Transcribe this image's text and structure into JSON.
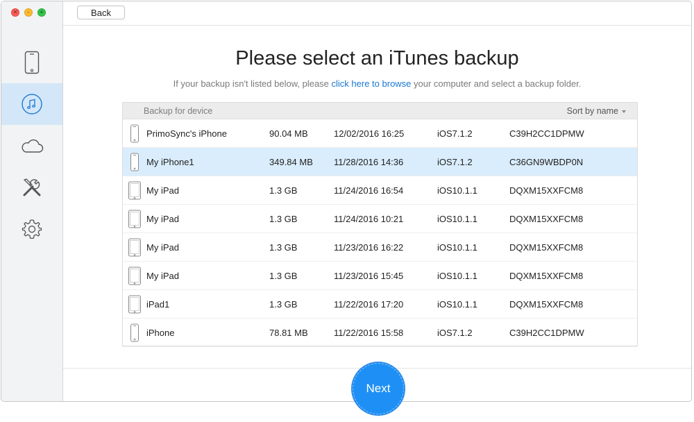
{
  "window": {
    "traffic_lights": {
      "close_glyph": "×",
      "min_glyph": "–",
      "max_glyph": "+"
    }
  },
  "sidebar": {
    "items": [
      {
        "icon": "iphone-icon",
        "active": false
      },
      {
        "icon": "itunes-music-note-icon",
        "active": true
      },
      {
        "icon": "icloud-icon",
        "active": false
      },
      {
        "icon": "tools-icon",
        "active": false
      },
      {
        "icon": "gear-icon",
        "active": false
      }
    ]
  },
  "toolbar": {
    "back_label": "Back"
  },
  "main": {
    "title": "Please select an iTunes backup",
    "subtitle_prefix": "If your backup isn't listed below, please ",
    "subtitle_link": "click here to browse",
    "subtitle_suffix": " your computer and select a backup folder."
  },
  "table": {
    "header_label": "Backup for device",
    "sort_label": "Sort by name",
    "rows": [
      {
        "device": "iphone",
        "name": "PrimoSync's iPhone",
        "size": "90.04 MB",
        "date": "12/02/2016 16:25",
        "ios": "iOS7.1.2",
        "id": "C39H2CC1DPMW",
        "selected": false
      },
      {
        "device": "iphone",
        "name": "My iPhone1",
        "size": "349.84 MB",
        "date": "11/28/2016 14:36",
        "ios": "iOS7.1.2",
        "id": "C36GN9WBDP0N",
        "selected": true
      },
      {
        "device": "ipad",
        "name": "My iPad",
        "size": "1.3 GB",
        "date": "11/24/2016 16:54",
        "ios": "iOS10.1.1",
        "id": "DQXM15XXFCM8",
        "selected": false
      },
      {
        "device": "ipad",
        "name": "My iPad",
        "size": "1.3 GB",
        "date": "11/24/2016 10:21",
        "ios": "iOS10.1.1",
        "id": "DQXM15XXFCM8",
        "selected": false
      },
      {
        "device": "ipad",
        "name": "My iPad",
        "size": "1.3 GB",
        "date": "11/23/2016 16:22",
        "ios": "iOS10.1.1",
        "id": "DQXM15XXFCM8",
        "selected": false
      },
      {
        "device": "ipad",
        "name": "My iPad",
        "size": "1.3 GB",
        "date": "11/23/2016 15:45",
        "ios": "iOS10.1.1",
        "id": "DQXM15XXFCM8",
        "selected": false
      },
      {
        "device": "ipad",
        "name": "iPad1",
        "size": "1.3 GB",
        "date": "11/22/2016 17:20",
        "ios": "iOS10.1.1",
        "id": "DQXM15XXFCM8",
        "selected": false
      },
      {
        "device": "iphone",
        "name": "iPhone",
        "size": "78.81 MB",
        "date": "11/22/2016 15:58",
        "ios": "iOS7.1.2",
        "id": "C39H2CC1DPMW",
        "selected": false
      }
    ]
  },
  "footer": {
    "next_label": "Next"
  },
  "colors": {
    "accent": "#1e90f5",
    "link": "#1a78d2",
    "selected_row": "#daedfc",
    "sidebar_active": "#d3e7f8"
  }
}
